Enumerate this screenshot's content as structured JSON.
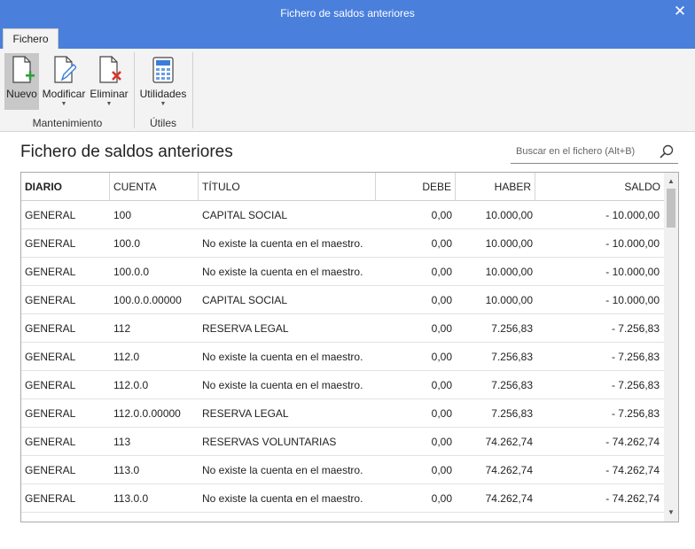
{
  "window": {
    "title": "Fichero de saldos anteriores"
  },
  "tabs": [
    {
      "label": "Fichero"
    }
  ],
  "ribbon": {
    "groups": [
      {
        "label": "Mantenimiento",
        "buttons": [
          "Nuevo",
          "Modificar",
          "Eliminar"
        ]
      },
      {
        "label": "Útiles",
        "buttons": [
          "Utilidades"
        ]
      }
    ]
  },
  "page": {
    "title": "Fichero de saldos anteriores"
  },
  "search": {
    "placeholder": "Buscar en el fichero (Alt+B)"
  },
  "table": {
    "columns": [
      "DIARIO",
      "CUENTA",
      "TÍTULO",
      "DEBE",
      "HABER",
      "SALDO"
    ],
    "rows": [
      [
        "GENERAL",
        "100",
        "CAPITAL SOCIAL",
        "0,00",
        "10.000,00",
        "- 10.000,00"
      ],
      [
        "GENERAL",
        "100.0",
        "No existe la cuenta en el maestro.",
        "0,00",
        "10.000,00",
        "- 10.000,00"
      ],
      [
        "GENERAL",
        "100.0.0",
        "No existe la cuenta en el maestro.",
        "0,00",
        "10.000,00",
        "- 10.000,00"
      ],
      [
        "GENERAL",
        "100.0.0.00000",
        "CAPITAL SOCIAL",
        "0,00",
        "10.000,00",
        "- 10.000,00"
      ],
      [
        "GENERAL",
        "112",
        "RESERVA LEGAL",
        "0,00",
        "7.256,83",
        "- 7.256,83"
      ],
      [
        "GENERAL",
        "112.0",
        "No existe la cuenta en el maestro.",
        "0,00",
        "7.256,83",
        "- 7.256,83"
      ],
      [
        "GENERAL",
        "112.0.0",
        "No existe la cuenta en el maestro.",
        "0,00",
        "7.256,83",
        "- 7.256,83"
      ],
      [
        "GENERAL",
        "112.0.0.00000",
        "RESERVA LEGAL",
        "0,00",
        "7.256,83",
        "- 7.256,83"
      ],
      [
        "GENERAL",
        "113",
        "RESERVAS VOLUNTARIAS",
        "0,00",
        "74.262,74",
        "- 74.262,74"
      ],
      [
        "GENERAL",
        "113.0",
        "No existe la cuenta en el maestro.",
        "0,00",
        "74.262,74",
        "- 74.262,74"
      ],
      [
        "GENERAL",
        "113.0.0",
        "No existe la cuenta en el maestro.",
        "0,00",
        "74.262,74",
        "- 74.262,74"
      ]
    ]
  },
  "colors": {
    "titlebar": "#4a7fdc",
    "ribbon_bg": "#f3f3f3",
    "active_button": "#c8c8c8",
    "add_icon": "#2e9e3e",
    "delete_icon": "#d9332b",
    "edit_icon": "#3b7dd8"
  }
}
